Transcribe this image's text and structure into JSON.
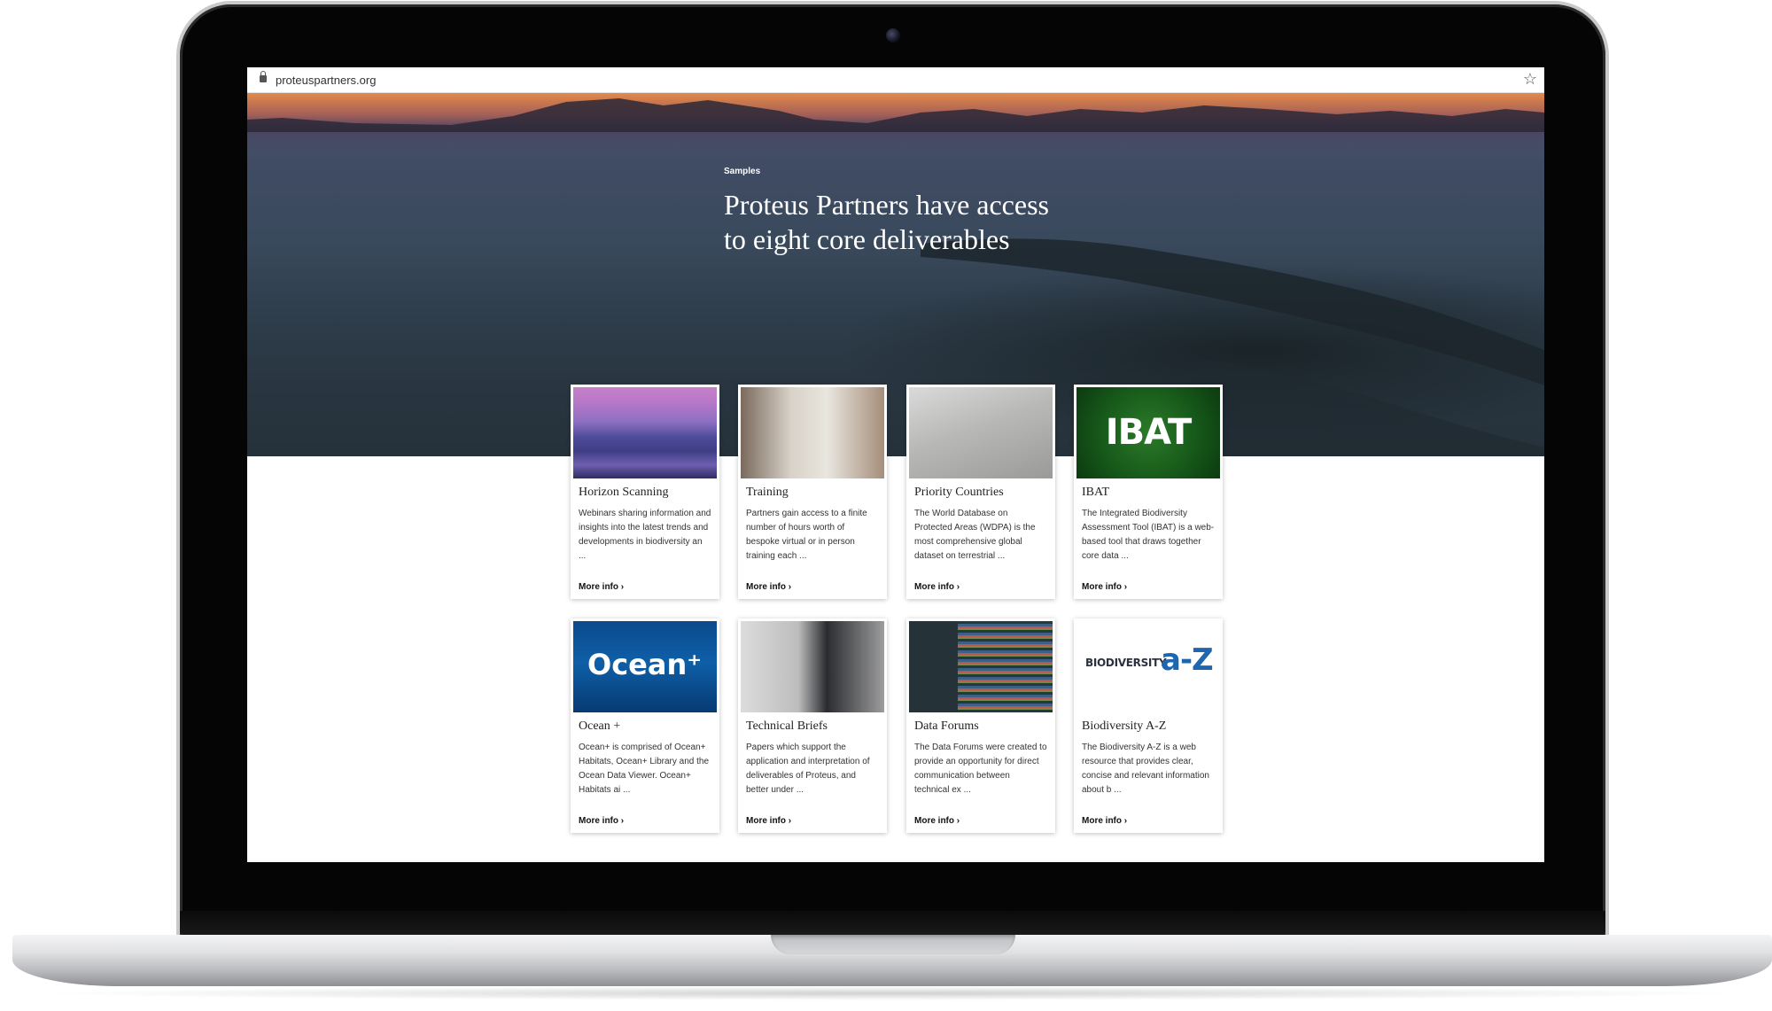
{
  "browser": {
    "url": "proteuspartners.org"
  },
  "hero": {
    "label": "Samples",
    "title": "Proteus Partners have access to eight core deliverables"
  },
  "cards": [
    {
      "title": "Horizon Scanning",
      "description": "Webinars sharing information and insights into the latest trends and developments in biodiversity an ...",
      "link": "More info ›"
    },
    {
      "title": "Training",
      "description": "Partners gain access to a finite number of hours worth of bespoke virtual or in person training each ...",
      "link": "More info ›"
    },
    {
      "title": "Priority Countries",
      "description": "The World Database on Protected Areas (WDPA) is the most comprehensive global dataset on terrestrial ...",
      "link": "More info ›"
    },
    {
      "title": "IBAT",
      "description": "The Integrated Biodiversity Assessment Tool (IBAT) is a web-based tool that draws together core data ...",
      "link": "More info ›",
      "image_text": "IBAT"
    },
    {
      "title": "Ocean +",
      "description": "Ocean+ is comprised of Ocean+ Habitats, Ocean+ Library and the Ocean Data Viewer. Ocean+ Habitats ai ...",
      "link": "More info ›",
      "image_text": "Ocean⁺"
    },
    {
      "title": "Technical Briefs",
      "description": "Papers which support the application and interpretation of deliverables of Proteus, and better under ...",
      "link": "More info ›"
    },
    {
      "title": "Data Forums",
      "description": "The Data Forums were created to provide an opportunity for direct communication between technical ex ...",
      "link": "More info ›"
    },
    {
      "title": "Biodiversity A-Z",
      "description": "The Biodiversity A-Z is a web resource that provides clear, concise and relevant information about b ...",
      "link": "More info ›",
      "image_text_1": "BIODIVERSITY",
      "image_text_2": "a-Z"
    }
  ]
}
